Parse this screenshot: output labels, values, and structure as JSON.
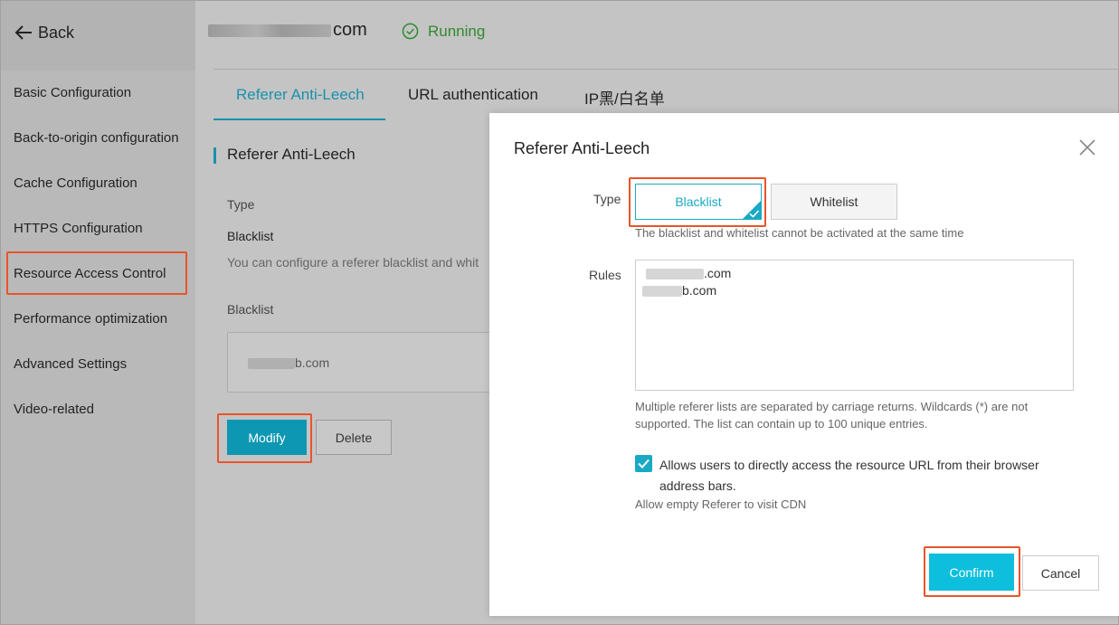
{
  "sidebar": {
    "back_label": "Back",
    "items": [
      {
        "label": "Basic Configuration"
      },
      {
        "label": "Back-to-origin configuration"
      },
      {
        "label": "Cache Configuration"
      },
      {
        "label": "HTTPS Configuration"
      },
      {
        "label": "Resource Access Control"
      },
      {
        "label": "Performance optimization"
      },
      {
        "label": "Advanced Settings"
      },
      {
        "label": "Video-related"
      }
    ]
  },
  "header": {
    "domain_suffix": "com",
    "status": "Running",
    "status_color": "#2e8b2e"
  },
  "tabs": [
    {
      "label": "Referer Anti-Leech"
    },
    {
      "label": "URL authentication"
    },
    {
      "label": "IP黑/白名单"
    }
  ],
  "panel": {
    "section_title": "Referer Anti-Leech",
    "type_label": "Type",
    "type_value": "Blacklist",
    "description": "You can configure a referer blacklist and whit",
    "blacklist_label": "Blacklist",
    "blacklist_entry_suffix": "b.com",
    "modify_label": "Modify",
    "delete_label": "Delete"
  },
  "dialog": {
    "title": "Referer Anti-Leech",
    "type_label": "Type",
    "blacklist_option": "Blacklist",
    "whitelist_option": "Whitelist",
    "type_help": "The blacklist and whitelist cannot be activated at the same time",
    "rules_label": "Rules",
    "rules": [
      ".com",
      "b.com"
    ],
    "rules_help": "Multiple referer lists are separated by carriage returns. Wildcards (*) are not supported. The list can contain up to 100 unique entries.",
    "checkbox_label": "Allows users to directly access the resource URL from their browser address bars.",
    "checkbox_help": "Allow empty Referer to visit CDN",
    "confirm_label": "Confirm",
    "cancel_label": "Cancel"
  },
  "colors": {
    "accent": "#1aa9c4",
    "highlight": "#e8542a"
  }
}
